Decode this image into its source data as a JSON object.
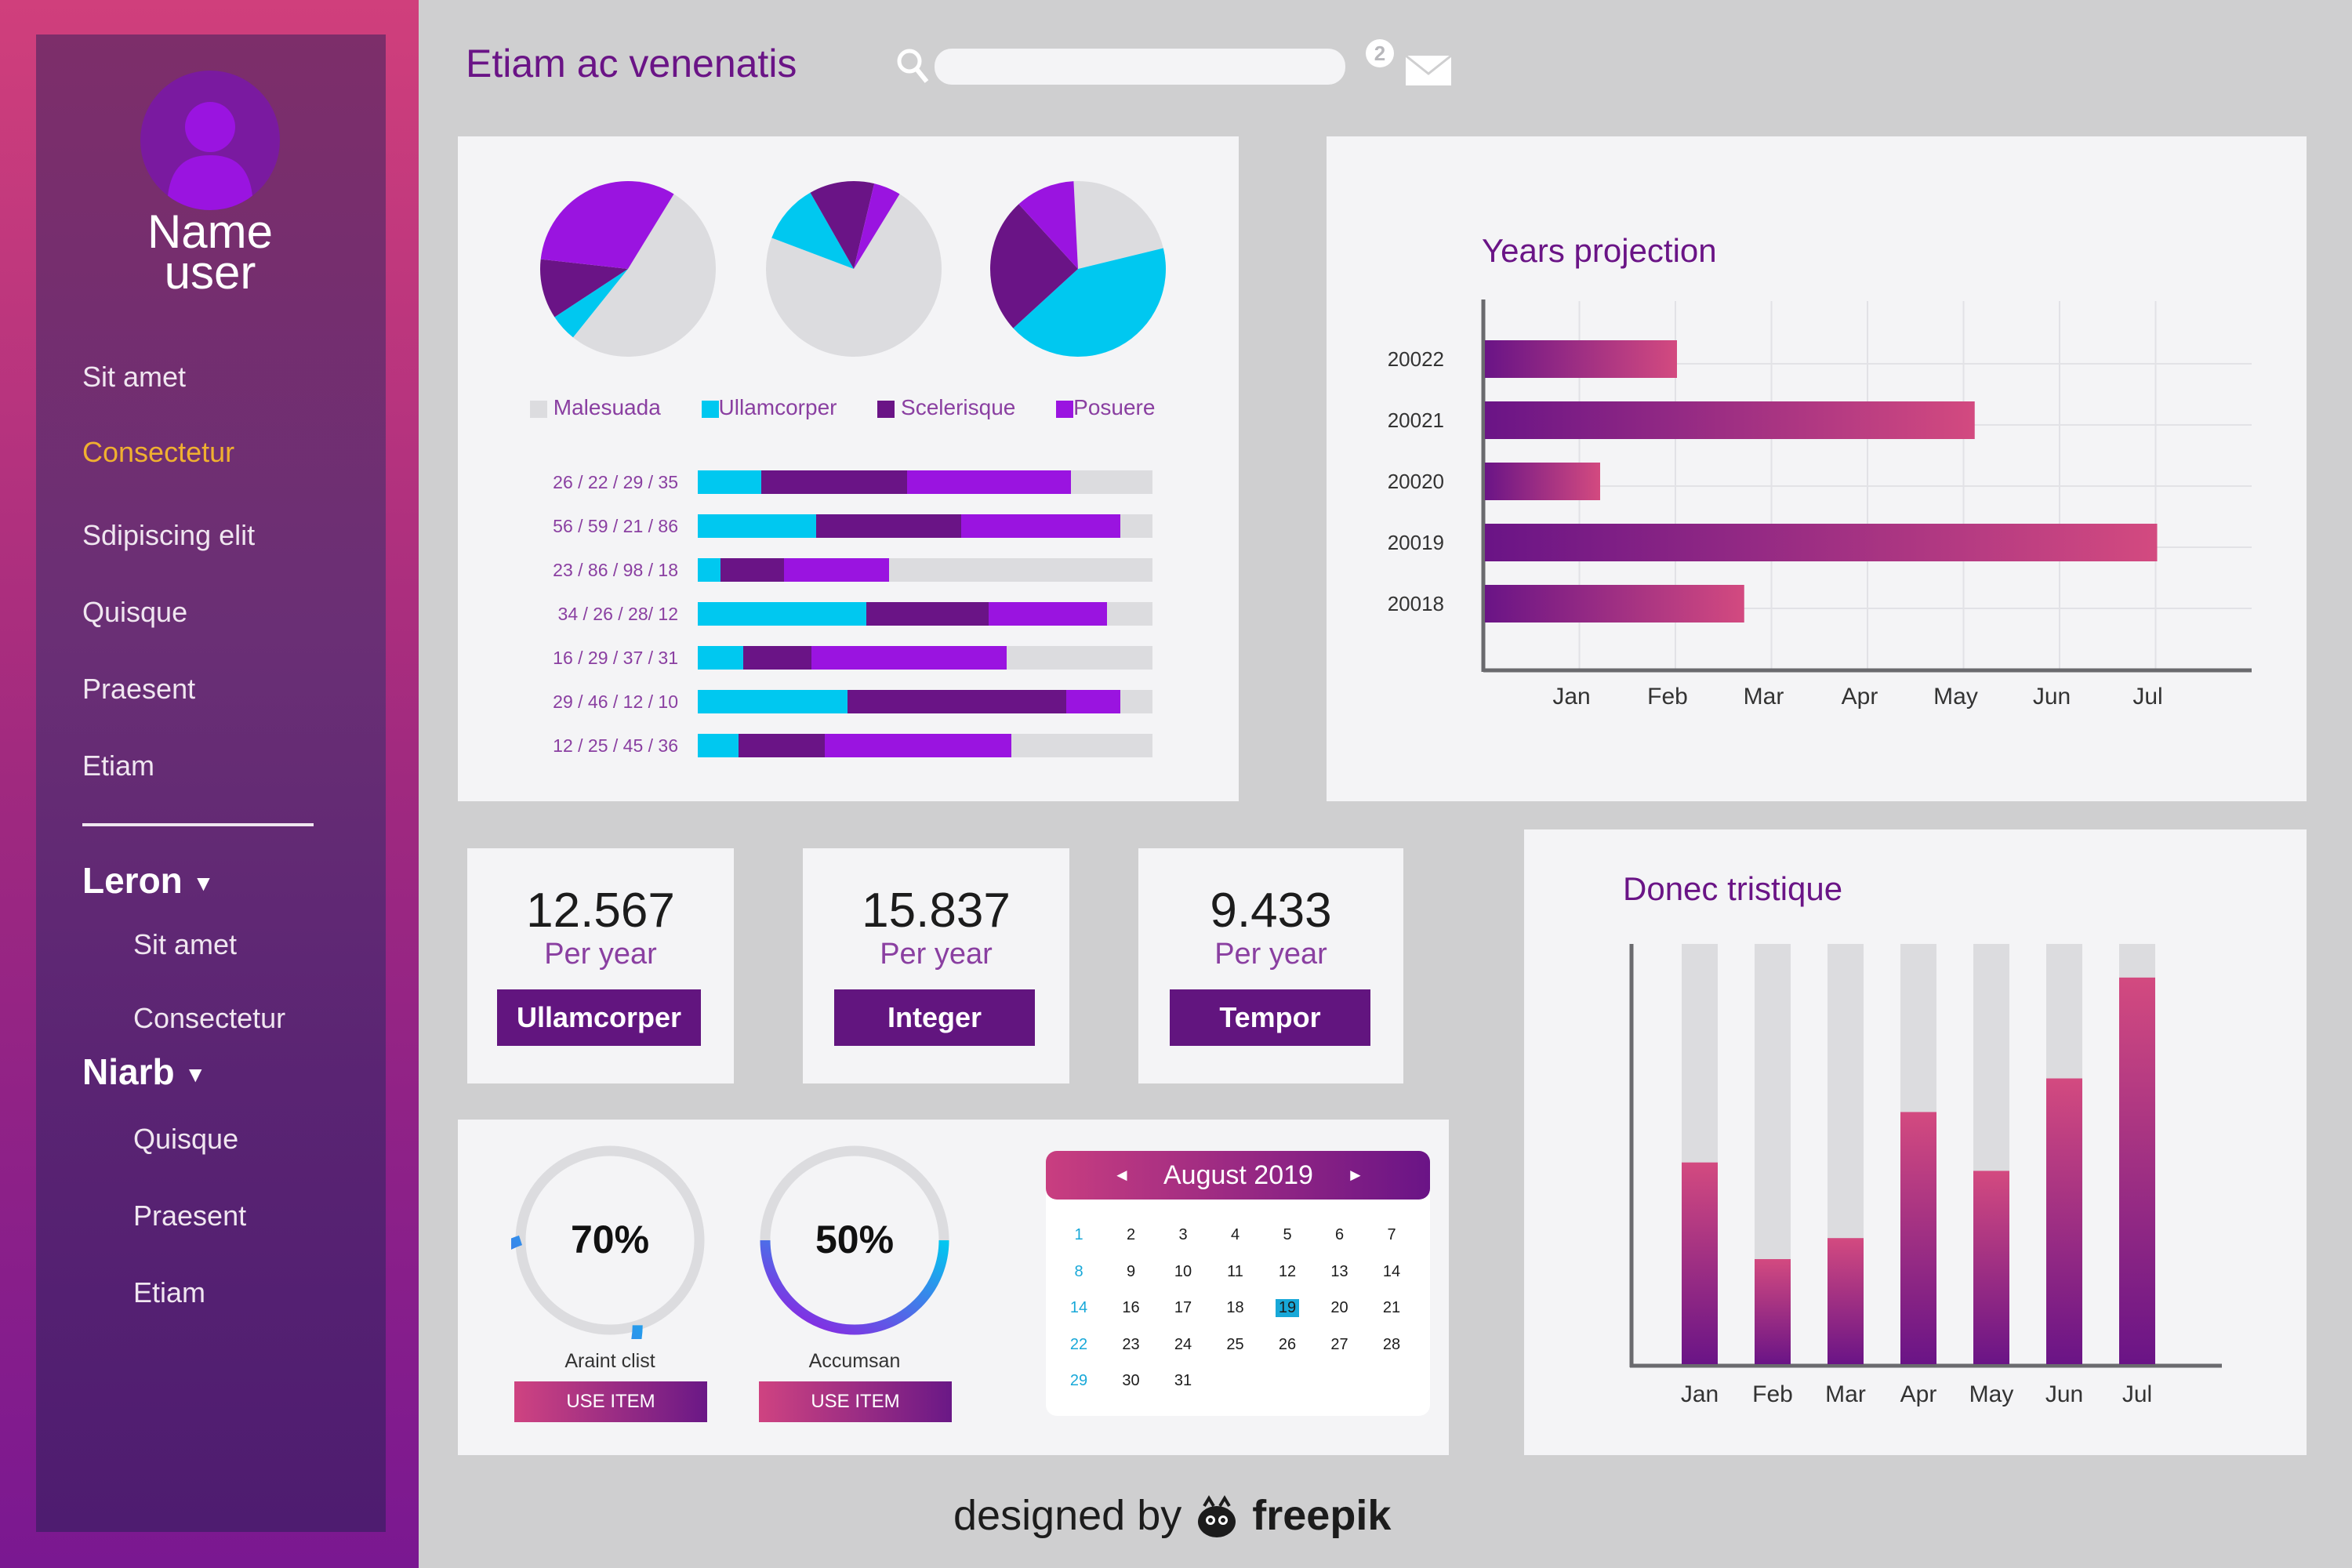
{
  "colors": {
    "cyan": "#00c8f0",
    "dark_purple": "#6a1486",
    "purple": "#9a14e0",
    "gray": "#dcdcdf",
    "pink": "#d34a80",
    "title_purple": "#6a1486"
  },
  "header": {
    "title": "Etiam ac venenatis",
    "search_placeholder": "",
    "notification_count": "2"
  },
  "sidebar": {
    "user_name_line1": "Name",
    "user_name_line2": "user",
    "items": [
      {
        "label": "Sit amet",
        "active": false
      },
      {
        "label": "Consectetur",
        "active": true
      },
      {
        "label": "Sdipiscing elit",
        "active": false
      },
      {
        "label": "Quisque",
        "active": false
      },
      {
        "label": "Praesent",
        "active": false
      },
      {
        "label": "Etiam",
        "active": false
      }
    ],
    "group1": {
      "label": "Leron",
      "arrow": "▼",
      "items": [
        "Sit amet",
        "Consectetur"
      ]
    },
    "group2": {
      "label": "Niarb",
      "arrow": "▼",
      "items": [
        "Quisque",
        "Praesent",
        "Etiam"
      ]
    }
  },
  "pies_panel": {
    "legend": [
      {
        "label": "Malesuada",
        "color": "#dcdcdf"
      },
      {
        "label": "Ullamcorper",
        "color": "#00c8f0"
      },
      {
        "label": "Scelerisque",
        "color": "#6a1486"
      },
      {
        "label": "Posuere",
        "color": "#9a14e0"
      }
    ],
    "pies": [
      [
        {
          "v": 52,
          "c": "#dcdcdf"
        },
        {
          "v": 5,
          "c": "#00c8f0"
        },
        {
          "v": 11,
          "c": "#6a1486"
        },
        {
          "v": 32,
          "c": "#9a14e0"
        }
      ],
      [
        {
          "v": 72,
          "c": "#dcdcdf"
        },
        {
          "v": 11,
          "c": "#00c8f0"
        },
        {
          "v": 12,
          "c": "#6a1486"
        },
        {
          "v": 5,
          "c": "#9a14e0"
        }
      ],
      [
        {
          "v": 22,
          "c": "#dcdcdf"
        },
        {
          "v": 42,
          "c": "#00c8f0"
        },
        {
          "v": 25,
          "c": "#6a1486"
        },
        {
          "v": 11,
          "c": "#9a14e0"
        }
      ]
    ],
    "rows": [
      {
        "label": "26 / 22 / 29 / 35",
        "values": [
          14,
          32,
          36
        ]
      },
      {
        "label": "56 / 59 / 21 / 86",
        "values": [
          26,
          32,
          35
        ]
      },
      {
        "label": "23 / 86 / 98 / 18",
        "values": [
          5,
          14,
          23
        ]
      },
      {
        "label": "34 / 26 / 28/ 12",
        "values": [
          37,
          27,
          26
        ]
      },
      {
        "label": "16 / 29 / 37 / 31",
        "values": [
          10,
          15,
          43
        ]
      },
      {
        "label": "29 / 46 / 12 / 10",
        "values": [
          33,
          48,
          12
        ]
      },
      {
        "label": "12 / 25 / 45 / 36",
        "values": [
          9,
          19,
          41
        ]
      }
    ]
  },
  "chart_data": [
    {
      "type": "bar",
      "title": "Years projection",
      "orientation": "horizontal",
      "categories": [
        "20022",
        "20021",
        "20020",
        "20019",
        "20018"
      ],
      "x_ticks": [
        "Jan",
        "Feb",
        "Mar",
        "Apr",
        "May",
        "Jun",
        "Jul"
      ],
      "values": [
        2,
        5.1,
        1.2,
        7,
        2.7
      ],
      "xlim": [
        0,
        8
      ],
      "grid": true
    },
    {
      "type": "bar",
      "title": "Donec tristique",
      "categories": [
        "Jan",
        "Feb",
        "Mar",
        "Apr",
        "May",
        "Jun",
        "Jul"
      ],
      "values": [
        0.48,
        0.25,
        0.3,
        0.6,
        0.46,
        0.68,
        0.92
      ],
      "ylim": [
        0,
        1
      ],
      "grid": false
    }
  ],
  "stats": [
    {
      "value": "12.567",
      "sub": "Per year",
      "button": "Ullamcorper"
    },
    {
      "value": "15.837",
      "sub": "Per year",
      "button": "Integer"
    },
    {
      "value": "9.433",
      "sub": "Per year",
      "button": "Tempor"
    }
  ],
  "gauges": [
    {
      "value": "70%",
      "fraction": 0.7,
      "label": "Araint clist",
      "button": "USE ITEM"
    },
    {
      "value": "50%",
      "fraction": 0.5,
      "label": "Accumsan",
      "button": "USE ITEM"
    }
  ],
  "calendar": {
    "month": "August 2019",
    "prev": "◄",
    "next": "►",
    "selected": "19",
    "weeks": [
      [
        "1",
        "2",
        "3",
        "4",
        "5",
        "6",
        "7"
      ],
      [
        "8",
        "9",
        "10",
        "11",
        "12",
        "13",
        "14"
      ],
      [
        "14",
        "16",
        "17",
        "18",
        "19",
        "20",
        "21"
      ],
      [
        "22",
        "23",
        "24",
        "25",
        "26",
        "27",
        "28"
      ],
      [
        "29",
        "30",
        "31",
        "",
        "",
        "",
        ""
      ]
    ]
  },
  "footer": {
    "designed_by": "designed by",
    "brand": "freepik"
  }
}
